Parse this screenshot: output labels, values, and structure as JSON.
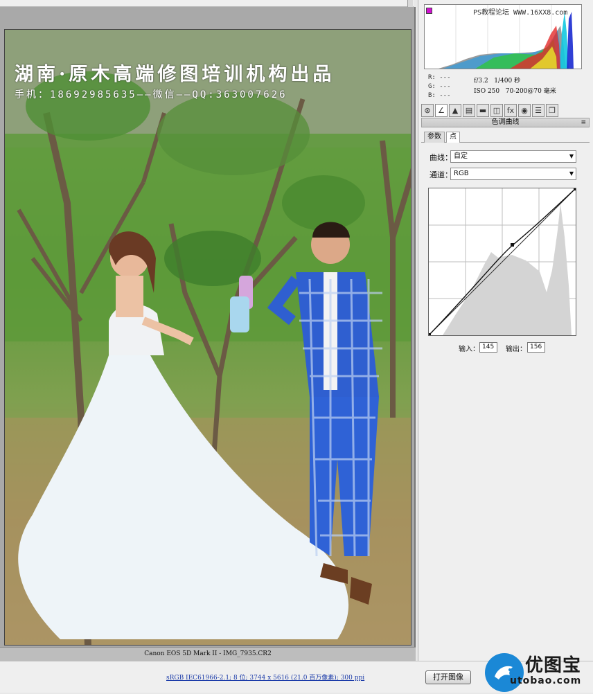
{
  "histogram": {
    "site_watermark": "PS教程论坛 WWW.16XX8.com"
  },
  "rgb_readout": {
    "r": "R:  ---",
    "g": "G:  ---",
    "b": "B:  ---"
  },
  "camera": {
    "aperture": "f/3.2",
    "shutter": "1/400 秒",
    "iso": "ISO 250",
    "lens": "70-200@70 毫米"
  },
  "tool_tabs": [
    "⊛",
    "∠",
    "▲",
    "▤",
    "▬",
    "◫",
    "fx",
    "◉",
    "☰",
    "❐"
  ],
  "panel": {
    "title": "色调曲线",
    "menu_icon": "≡",
    "sub_tabs": [
      "参数",
      "点"
    ],
    "curve_label": "曲线：",
    "curve_value": "自定",
    "channel_label": "通道：",
    "channel_value": "RGB",
    "input_label": "输入：",
    "input_value": "145",
    "output_label": "输出：",
    "output_value": "156"
  },
  "photo": {
    "watermark_title": "湖南·原木高端修图培训机构出品",
    "watermark_contact": "手机：18692985635——微信——QQ:363007626"
  },
  "status_bar": {
    "camera_file": "Canon EOS 5D Mark II -  IMG_7935.CR2"
  },
  "bottom": {
    "image_info": "sRGB IEC61966-2.1; 8 位; 3744 x 5616 (21.0 百万像素); 300 ppi",
    "open_button": "打开图像",
    "site_brand": "优图宝",
    "site_domain": "utobao.com"
  },
  "colors": {
    "accent_link": "#1a3aa8",
    "logo_blue": "#1b88d6",
    "clip_warning": "#d010d0"
  }
}
